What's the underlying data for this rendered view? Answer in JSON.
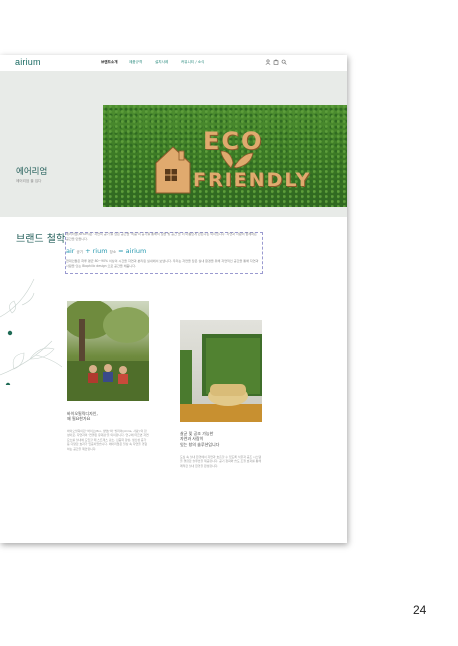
{
  "header": {
    "logo": "airium",
    "nav": [
      "브랜드소개",
      "제품규격",
      "설치사례",
      "커뮤니티 / 소식"
    ]
  },
  "hero": {
    "title": "에어리엄",
    "subtitle": "에어리엄 을 입다",
    "image_words": [
      "ECO",
      "FRIENDLY"
    ]
  },
  "brand": {
    "title": "브랜드 철학",
    "para1": "에어리엄(airium)은 '자연의 공기'를 담은 공간을 '비움'의 공기를 통해서 실을 빛 공간 을 더 아름답게 만든다는 의미입니다. 자연과 사람이 함께하는 공간을 만듭니다.",
    "air_line": {
      "p1": "air",
      "p2": "공기",
      "p3": "+ rium",
      "p4": "장소",
      "p5": "= airium"
    },
    "para2": "현대인들은 하루 평균 80~90% 이상의 시간을 자연과 분리된 실내에서 보냅니다. 우리는 자연을 담은 실내 환경을 위해 자연적인 공간을 통해 자연과 사람을 잇는 Biophilic design 으로 공간을 채웁니다."
  },
  "card1": {
    "title_lines": [
      "바이오필릭디자인,",
      "왜 필요한가요"
    ],
    "body": "바이오필릭이란 '바이오(Bio, 생명)'와 '필리아(philia, 사랑)'의 합성어로, 자연과의 '연결된 유대감'을 의미합니다. 연구에 따르면 자연 요소를 실내에 도입할 때 스트레스 감소, 집중력 향상, 생산성 증가 등 다양한 효과가 입증되었습니다. 에어리엄은 일상 속 자연을 경험하는 공간을 제안합니다."
  },
  "card2": {
    "title_lines": [
      "살균 및 공조 가능한",
      "자연과 사람이",
      "잇는 창의 솔루션입니다"
    ],
    "body": "도심 속 실내 환경에서 자연과 호흡할 수 있도록 식물과 공조 시스템을 결합한 솔루션을 제공합니다. 공기 정화와 습도 조절 효과를 통해 쾌적한 실내 환경을 완성합니다."
  },
  "page_number": "24",
  "colors": {
    "brand": "#1f5c57",
    "accent": "#2a9ab0",
    "hero_bg": "#e8ebe8"
  }
}
